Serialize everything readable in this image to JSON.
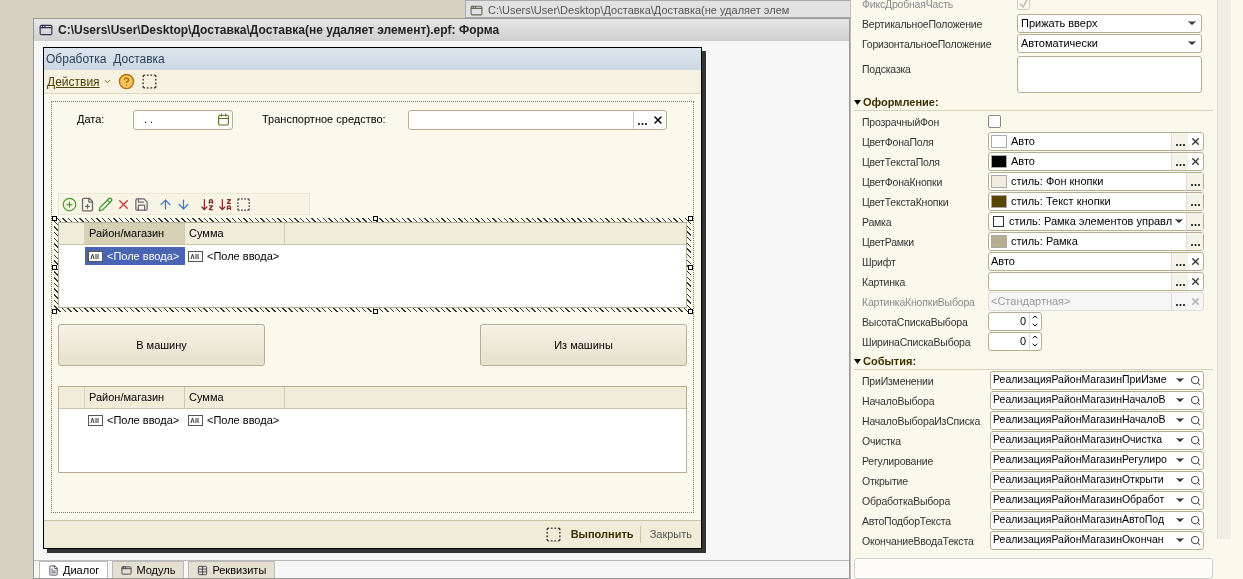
{
  "background_window": {
    "title": "C:\\Users\\User\\Desktop\\Доставка\\Доставка(не удаляет элем"
  },
  "designer": {
    "title": "C:\\Users\\User\\Desktop\\Доставка\\Доставка(не удаляет элемент).epf: Форма",
    "form": {
      "title": "Обработка  Доставка",
      "actions_menu": "Действия",
      "fields": [
        {
          "label": "Дата:",
          "value": ". .",
          "kind": "date"
        },
        {
          "label": "Транспортное средство:",
          "kind": "reference"
        }
      ],
      "tables": [
        {
          "selected": true,
          "columns": [
            {
              "label": "Район/магазин",
              "selected": true
            },
            {
              "label": "Сумма",
              "selected": false
            }
          ],
          "cells": [
            {
              "text": "<Поле ввода>",
              "selected": true
            },
            {
              "text": "<Поле ввода>",
              "selected": false
            }
          ]
        },
        {
          "selected": false,
          "columns": [
            {
              "label": "Район/магазин",
              "selected": false
            },
            {
              "label": "Сумма",
              "selected": false
            }
          ],
          "cells": [
            {
              "text": "<Поле ввода>",
              "selected": false
            },
            {
              "text": "<Поле ввода>",
              "selected": false
            }
          ]
        }
      ],
      "buttons": [
        "В машину",
        "Из машины"
      ],
      "footer_buttons": [
        {
          "label": "Выполнить",
          "default": true
        },
        {
          "label": "Закрыть",
          "default": false
        }
      ]
    },
    "tabs": [
      {
        "label": "Диалог",
        "selected": true
      },
      {
        "label": "Модуль",
        "selected": false
      },
      {
        "label": "Реквизиты",
        "selected": false
      }
    ]
  },
  "properties": {
    "groups": [
      {
        "rows": [
          {
            "label": "ФиксДробнаяЧасть",
            "kind": "checkbox",
            "checked": true,
            "disabled": true
          },
          {
            "label": "ВертикальноеПоложение",
            "kind": "select",
            "value": "Прижать вверх",
            "disabled": false
          },
          {
            "label": "ГоризонтальноеПоложение",
            "kind": "select",
            "value": "Автоматически",
            "disabled": false
          },
          {
            "label": "Подсказка",
            "kind": "textarea",
            "disabled": false
          }
        ]
      },
      {
        "title": "Оформление:",
        "expanded": true,
        "rows": [
          {
            "label": "ПрозрачныйФон",
            "kind": "checkbox",
            "checked": false,
            "disabled": false
          },
          {
            "label": "ЦветФонаПоля",
            "kind": "color",
            "color": "#ffffff",
            "value": "Авто",
            "clearable": true,
            "disabled": false
          },
          {
            "label": "ЦветТекстаПоля",
            "kind": "color",
            "color": "#000000",
            "value": "Авто",
            "clearable": true,
            "disabled": false
          },
          {
            "label": "ЦветФонаКнопки",
            "kind": "color",
            "color": "#f0ede0",
            "value": "стиль: Фон кнопки",
            "clearable": false,
            "disabled": false
          },
          {
            "label": "ЦветТекстаКнопки",
            "kind": "color",
            "color": "#5a4500",
            "value": "стиль: Текст кнопки",
            "clearable": false,
            "disabled": false
          },
          {
            "label": "Рамка",
            "kind": "frame",
            "value": "стиль: Рамка элементов управл",
            "disabled": false
          },
          {
            "label": "ЦветРамки",
            "kind": "color",
            "color": "#b5ae95",
            "value": "стиль: Рамка",
            "clearable": false,
            "disabled": false
          },
          {
            "label": "Шрифт",
            "kind": "text",
            "value": "Авто",
            "clearable": true,
            "disabled": false
          },
          {
            "label": "Картинка",
            "kind": "text",
            "value": "",
            "clearable": true,
            "disabled": false
          },
          {
            "label": "КартинкаКнопкиВыбора",
            "kind": "text",
            "value": "<Стандартная>",
            "clearable": true,
            "disabled": true
          },
          {
            "label": "ВысотаСпискаВыбора",
            "kind": "spin",
            "value": "0",
            "disabled": false
          },
          {
            "label": "ШиринаСпискаВыбора",
            "kind": "spin",
            "value": "0",
            "disabled": false
          }
        ]
      },
      {
        "title": "События:",
        "expanded": true,
        "rows": [
          {
            "label": "ПриИзменении",
            "kind": "event",
            "value": "РеализацияРайонМагазинПриИзме",
            "disabled": false
          },
          {
            "label": "НачалоВыбора",
            "kind": "event",
            "value": "РеализацияРайонМагазинНачалоВ",
            "disabled": false
          },
          {
            "label": "НачалоВыбораИзСписка",
            "kind": "event",
            "value": "РеализацияРайонМагазинНачалоВ",
            "disabled": false
          },
          {
            "label": "Очистка",
            "kind": "event",
            "value": "РеализацияРайонМагазинОчистка",
            "disabled": false
          },
          {
            "label": "Регулирование",
            "kind": "event",
            "value": "РеализацияРайонМагазинРегулиро",
            "disabled": false
          },
          {
            "label": "Открытие",
            "kind": "event",
            "value": "РеализацияРайонМагазинОткрыти",
            "disabled": false
          },
          {
            "label": "ОбработкаВыбора",
            "kind": "event",
            "value": "РеализацияРайонМагазинОбработ",
            "disabled": false
          },
          {
            "label": "АвтоПодборТекста",
            "kind": "event",
            "value": "РеализацияРайонМагазинАвтоПод",
            "disabled": false
          },
          {
            "label": "ОкончаниеВводаТекста",
            "kind": "event",
            "value": "РеализацияРайонМагазинОкончан",
            "disabled": false
          }
        ]
      }
    ]
  }
}
